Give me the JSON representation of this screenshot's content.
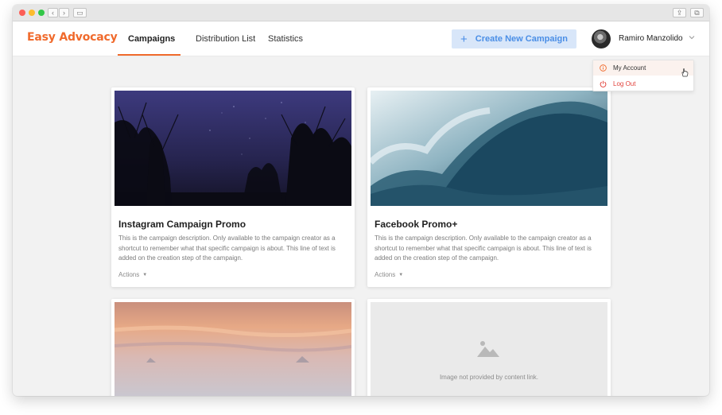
{
  "browser": {
    "back_glyph": "‹",
    "forward_glyph": "›",
    "sidebar_glyph": "▭",
    "share_glyph": "⇪",
    "tabs_glyph": "⧉"
  },
  "app": {
    "brand": "Easy Advocacy",
    "accent_color": "#f06a2c"
  },
  "nav": {
    "tabs": [
      {
        "label": "Campaigns",
        "active": true
      },
      {
        "label": "Distribution List",
        "active": false
      },
      {
        "label": "Statistics",
        "active": false
      }
    ]
  },
  "create_button": {
    "plus": "+",
    "label": "Create New Campaign"
  },
  "user": {
    "name": "Ramiro Manzolido",
    "menu": [
      {
        "label": "My Account",
        "icon": "info-icon"
      },
      {
        "label": "Log Out",
        "icon": "power-icon"
      }
    ]
  },
  "cards": [
    {
      "title": "Instagram Campaign Promo",
      "description": "This is the campaign description. Only available to the campaign creator as a shortcut to remember what that specific campaign is about. This line of text is added on the creation step of the campaign.",
      "actions_label": "Actions",
      "image": "night-sky-trees"
    },
    {
      "title": "Facebook Promo+",
      "description": "This is the campaign description. Only available to the campaign creator as a shortcut to remember what that specific campaign is about. This line of text is added on the creation step of the campaign.",
      "actions_label": "Actions",
      "image": "ocean-wave"
    },
    {
      "image": "misty-sunset"
    },
    {
      "image": "placeholder",
      "placeholder_text": "Image not provided by content link."
    }
  ]
}
